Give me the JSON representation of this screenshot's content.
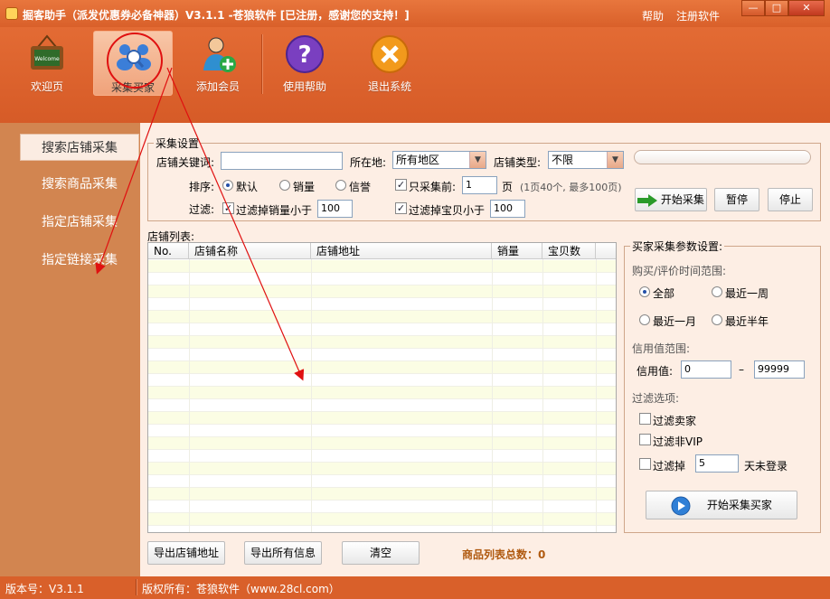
{
  "window": {
    "title": "掘客助手（派发优惠券必备神器）V3.1.1  -苍狼软件 [已注册，感谢您的支持！]",
    "help_link": "帮助",
    "register_link": "注册软件",
    "minimize": "—",
    "maximize": "□",
    "close": "✕"
  },
  "toolbar": {
    "items": [
      {
        "label": "欢迎页",
        "icon": "welcome-board-icon"
      },
      {
        "label": "采集买家",
        "icon": "collect-buyers-icon"
      },
      {
        "label": "添加会员",
        "icon": "add-member-icon"
      },
      {
        "label": "使用帮助",
        "icon": "help-icon"
      },
      {
        "label": "退出系统",
        "icon": "exit-icon"
      }
    ]
  },
  "sidebar": {
    "items": [
      {
        "label": "搜索店铺采集"
      },
      {
        "label": "搜索商品采集"
      },
      {
        "label": "指定店铺采集"
      },
      {
        "label": "指定链接采集"
      }
    ]
  },
  "settings": {
    "legend": "采集设置",
    "keyword_label": "店铺关键词:",
    "keyword_value": "",
    "location_label": "所在地:",
    "location_value": "所有地区",
    "shop_type_label": "店铺类型:",
    "shop_type_value": "不限",
    "sort_label": "排序:",
    "sort_options": [
      "默认",
      "销量",
      "信誉"
    ],
    "only_collect_label": "只采集前:",
    "only_collect_value": "1",
    "page_label": "页",
    "page_hint": "(1页40个, 最多100页)",
    "filter_label": "过滤:",
    "filter_sales_label": "过滤掉销量小于",
    "filter_sales_value": "100",
    "filter_items_label": "过滤掉宝贝小于",
    "filter_items_value": "100",
    "start_button": "开始采集",
    "pause_button": "暂停",
    "stop_button": "停止"
  },
  "shop_list": {
    "label": "店铺列表:",
    "columns": [
      "No.",
      "店铺名称",
      "店铺地址",
      "销量",
      "宝贝数"
    ]
  },
  "buyer_settings": {
    "legend": "买家采集参数设置:",
    "time_range_label": "购买/评价时间范围:",
    "time_options": [
      "全部",
      "最近一周",
      "最近一月",
      "最近半年"
    ],
    "credit_range_label": "信用值范围:",
    "credit_label": "信用值:",
    "credit_min": "0",
    "credit_dash": "–",
    "credit_max": "99999",
    "filter_options_label": "过滤选项:",
    "filter_seller": "过滤卖家",
    "filter_non_vip": "过滤非VIP",
    "filter_inactive": "过滤掉",
    "filter_inactive_days": "5",
    "filter_inactive_suffix": "天未登录",
    "start_buyers_button": "开始采集买家"
  },
  "bottom": {
    "export_shop_button": "导出店铺地址",
    "export_all_button": "导出所有信息",
    "clear_button": "清空",
    "total_label": "商品列表总数：0"
  },
  "status": {
    "version": "版本号：V3.1.1",
    "copyright": "版权所有：苍狼软件（www.28cl.com）"
  },
  "colors": {
    "accent_orange": "#d9602a",
    "sidebar_bg": "#d28550",
    "panel_bg": "#fdeee4",
    "annotation_red": "#e01010",
    "total_text": "#b05a10"
  }
}
